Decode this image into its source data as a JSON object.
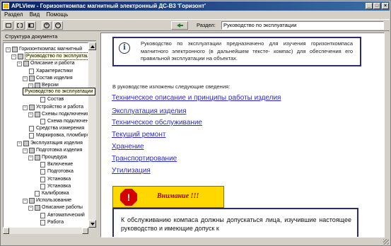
{
  "window": {
    "title": "APLView - Горизонткомпас магнитный электронный ДС-В3 'Горизонт'",
    "buttons": {
      "minimize": "_",
      "maximize": "□",
      "close": "×"
    }
  },
  "menu": [
    "Раздел",
    "Вид",
    "Помощь"
  ],
  "toolbar": {
    "icons": [
      "panel-icon",
      "list-icon",
      "panel-right-icon",
      "zoom-in-icon",
      "zoom-out-icon"
    ],
    "zoom_in_glyph": "+",
    "zoom_out_glyph": "−",
    "back_icon": "back-arrow-icon",
    "section_label": "Раздел:",
    "section_value": "Руководство по эксплуатации"
  },
  "tree": {
    "title": "Структура документа",
    "tooltip": "Руководство по эксплуатации",
    "nodes": [
      {
        "level": 0,
        "expander": "−",
        "icon": "book",
        "text": "Горизонткомпас магнитный",
        "selected": false
      },
      {
        "level": 1,
        "expander": "−",
        "icon": "book",
        "text": "Руководство по эксплуатации",
        "selected": true
      },
      {
        "level": 2,
        "expander": "−",
        "icon": "book",
        "text": "Описание и работа",
        "selected": false
      },
      {
        "level": 3,
        "expander": "",
        "icon": "doc",
        "text": "Характеристики",
        "selected": false
      },
      {
        "level": 3,
        "expander": "−",
        "icon": "book",
        "text": "Состав изделия",
        "selected": false
      },
      {
        "level": 4,
        "expander": "−",
        "icon": "book",
        "text": "Версии",
        "selected": false
      },
      {
        "level": 5,
        "expander": "",
        "icon": "doc",
        "text": "Состав",
        "selected": false
      },
      {
        "level": 5,
        "expander": "",
        "icon": "doc",
        "text": "Состав",
        "selected": false
      },
      {
        "level": 3,
        "expander": "−",
        "icon": "book",
        "text": "Устройство и работа",
        "selected": false
      },
      {
        "level": 4,
        "expander": "−",
        "icon": "book",
        "text": "Схемы подключения",
        "selected": false
      },
      {
        "level": 5,
        "expander": "",
        "icon": "doc",
        "text": "Схема подключения",
        "selected": false
      },
      {
        "level": 3,
        "expander": "",
        "icon": "doc",
        "text": "Средства измерения",
        "selected": false
      },
      {
        "level": 3,
        "expander": "",
        "icon": "doc",
        "text": "Маркировка, пломбирование",
        "selected": false
      },
      {
        "level": 2,
        "expander": "−",
        "icon": "book",
        "text": "Эксплуатация изделия",
        "selected": false
      },
      {
        "level": 3,
        "expander": "−",
        "icon": "book",
        "text": "Подготовка изделия",
        "selected": false
      },
      {
        "level": 4,
        "expander": "−",
        "icon": "book",
        "text": "Процедура",
        "selected": false
      },
      {
        "level": 5,
        "expander": "",
        "icon": "doc",
        "text": "Включение",
        "selected": false
      },
      {
        "level": 5,
        "expander": "",
        "icon": "doc",
        "text": "Подготовка",
        "selected": false
      },
      {
        "level": 5,
        "expander": "",
        "icon": "doc",
        "text": "Установка",
        "selected": false
      },
      {
        "level": 5,
        "expander": "",
        "icon": "doc",
        "text": "Установка",
        "selected": false
      },
      {
        "level": 4,
        "expander": "",
        "icon": "doc",
        "text": "Калибровка",
        "selected": false
      },
      {
        "level": 3,
        "expander": "−",
        "icon": "book",
        "text": "Использование",
        "selected": false
      },
      {
        "level": 4,
        "expander": "−",
        "icon": "book",
        "text": "Описание работы",
        "selected": false
      },
      {
        "level": 5,
        "expander": "",
        "icon": "doc",
        "text": "Автоматический",
        "selected": false
      },
      {
        "level": 5,
        "expander": "",
        "icon": "doc",
        "text": "Работа",
        "selected": false
      }
    ]
  },
  "content": {
    "info_icon": "i",
    "info_text": "Руководство по эксплуатации предназначено для изучения горизонткомпаса магнитного электронного (в дальнейшем тексте- компас) для обеспечения его правильной эксплуатации на объектах.",
    "intro": "В руководстве изложены следующие сведения:",
    "links": [
      "Техническое описание и принципы работы изделия",
      "Эксплуатация изделия",
      "Техническое обслуживание",
      "Текущий ремонт",
      "Хранение",
      "Транспортирование",
      "Утилизация"
    ],
    "warning_glyph": "!",
    "warning_title": "Внимание !!!",
    "warning_text": "К обслуживанию компаса должны допускаться лица, изучившие настоящее руководство и имеющие допуск к"
  },
  "colors": {
    "titlebar_start": "#0a246a",
    "titlebar_end": "#3a6ea5",
    "link": "#2a2ad0",
    "warning_bg": "#ffd800",
    "stop_sign": "#d40000",
    "box_border": "#2b2b70"
  }
}
